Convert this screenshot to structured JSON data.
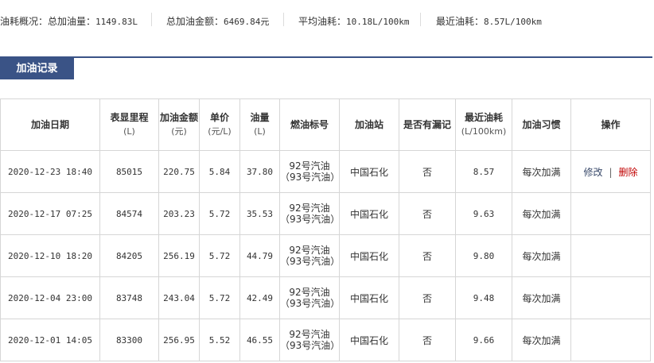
{
  "summary": {
    "total_volume_label": "油耗概况：总加油量：",
    "total_volume_value": "1149.83L",
    "total_amount_label": "总加油金额：",
    "total_amount_value": "6469.84元",
    "avg_consumption_label": "平均油耗：",
    "avg_consumption_value": "10.18L/100km",
    "recent_consumption_label": "最近油耗：",
    "recent_consumption_value": "8.57L/100km"
  },
  "section": {
    "title": "加油记录"
  },
  "table": {
    "headers": [
      {
        "label": "加油日期",
        "sub": ""
      },
      {
        "label": "表显里程",
        "sub": "(L)"
      },
      {
        "label": "加油金额",
        "sub": "(元)"
      },
      {
        "label": "单价",
        "sub": "(元/L)"
      },
      {
        "label": "油量",
        "sub": "(L)"
      },
      {
        "label": "燃油标号",
        "sub": ""
      },
      {
        "label": "加油站",
        "sub": ""
      },
      {
        "label": "是否有漏记",
        "sub": ""
      },
      {
        "label": "最近油耗",
        "sub": "(L/100km)"
      },
      {
        "label": "加油习惯",
        "sub": ""
      },
      {
        "label": "操作",
        "sub": ""
      }
    ],
    "rows": [
      {
        "date": "2020-12-23 18:40",
        "odometer": "85015",
        "amount": "220.75",
        "price": "5.84",
        "volume": "37.80",
        "fuel": "92号汽油（93号汽油）",
        "station": "中国石化",
        "missed": "否",
        "consumption": "8.57",
        "habit": "每次加满",
        "edit": "修改",
        "sep": "|",
        "del": "删除"
      },
      {
        "date": "2020-12-17 07:25",
        "odometer": "84574",
        "amount": "203.23",
        "price": "5.72",
        "volume": "35.53",
        "fuel": "92号汽油（93号汽油）",
        "station": "中国石化",
        "missed": "否",
        "consumption": "9.63",
        "habit": "每次加满",
        "edit": "",
        "sep": "",
        "del": ""
      },
      {
        "date": "2020-12-10 18:20",
        "odometer": "84205",
        "amount": "256.19",
        "price": "5.72",
        "volume": "44.79",
        "fuel": "92号汽油（93号汽油）",
        "station": "中国石化",
        "missed": "否",
        "consumption": "9.80",
        "habit": "每次加满",
        "edit": "",
        "sep": "",
        "del": ""
      },
      {
        "date": "2020-12-04 23:00",
        "odometer": "83748",
        "amount": "243.04",
        "price": "5.72",
        "volume": "42.49",
        "fuel": "92号汽油（93号汽油）",
        "station": "中国石化",
        "missed": "否",
        "consumption": "9.48",
        "habit": "每次加满",
        "edit": "",
        "sep": "",
        "del": ""
      },
      {
        "date": "2020-12-01 14:05",
        "odometer": "83300",
        "amount": "256.95",
        "price": "5.52",
        "volume": "46.55",
        "fuel": "92号汽油（93号汽油）",
        "station": "中国石化",
        "missed": "否",
        "consumption": "9.66",
        "habit": "每次加满",
        "edit": "",
        "sep": "",
        "del": ""
      }
    ]
  },
  "colors": {
    "accent": "#3a5386",
    "delete": "#c00000",
    "border": "#d6d6d6"
  }
}
